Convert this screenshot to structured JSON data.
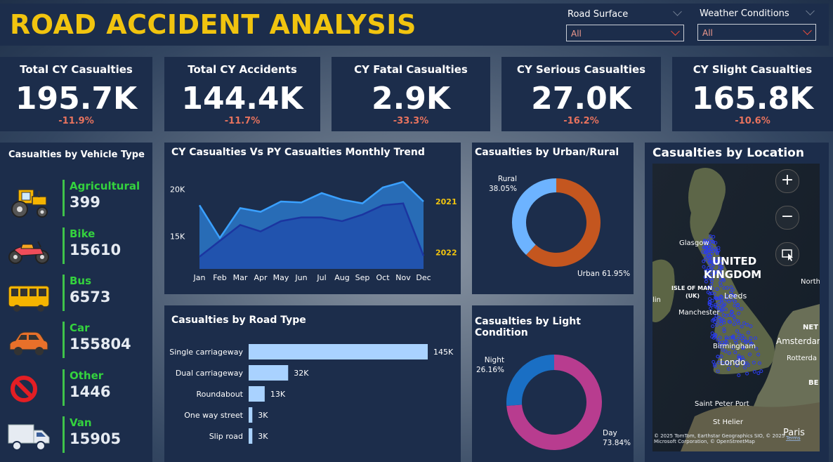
{
  "header": {
    "title": "ROAD ACCIDENT ANALYSIS"
  },
  "filters": [
    {
      "label": "Road Surface",
      "value": "All"
    },
    {
      "label": "Weather Conditions",
      "value": "All"
    }
  ],
  "kpis": [
    {
      "title": "Total CY Casualties",
      "value": "195.7K",
      "change": "-11.9%"
    },
    {
      "title": "Total CY Accidents",
      "value": "144.4K",
      "change": "-11.7%"
    },
    {
      "title": "CY Fatal Casualties",
      "value": "2.9K",
      "change": "-33.3%"
    },
    {
      "title": "CY Serious Casualties",
      "value": "27.0K",
      "change": "-16.2%"
    },
    {
      "title": "CY Slight Casualties",
      "value": "165.8K",
      "change": "-10.6%"
    }
  ],
  "vehicle_panel": {
    "title": "Casualties by Vehicle Type",
    "items": [
      {
        "label": "Agricultural",
        "value": "399",
        "icon": "tractor-icon"
      },
      {
        "label": "Bike",
        "value": "15610",
        "icon": "motorbike-icon"
      },
      {
        "label": "Bus",
        "value": "6573",
        "icon": "bus-icon"
      },
      {
        "label": "Car",
        "value": "155804",
        "icon": "car-icon"
      },
      {
        "label": "Other",
        "value": "1446",
        "icon": "prohibited-icon"
      },
      {
        "label": "Van",
        "value": "15905",
        "icon": "van-icon"
      }
    ]
  },
  "map": {
    "title": "Casualties by Location",
    "labels": [
      "Glasgow",
      "UNITED",
      "KINGDOM",
      "ISLE OF MAN",
      "(UK)",
      "Leeds",
      "Manchester",
      "Birmingham",
      "Londo",
      "NET",
      "Amsterdam",
      "Rotterda",
      "BE",
      "North",
      "lin",
      "Saint Peter Port",
      "St Helier",
      "Paris",
      "© 2025 TomTom, Earthstar Geographics SIO, © 2025 Microsoft Corporation, © OpenStreetMap",
      "Terms"
    ],
    "controls": {
      "zoom_in": "+",
      "zoom_out": "−"
    }
  },
  "chart_data": [
    {
      "type": "area",
      "title": "CY Casualties Vs PY Casualties Monthly Trend",
      "categories": [
        "Jan",
        "Feb",
        "Mar",
        "Apr",
        "May",
        "Jun",
        "Jul",
        "Aug",
        "Sep",
        "Oct",
        "Nov",
        "Dec"
      ],
      "series": [
        {
          "name": "2021",
          "values": [
            18300,
            14800,
            18000,
            17600,
            18700,
            18600,
            19600,
            18900,
            18500,
            20200,
            20800,
            18700
          ],
          "color": "#2f8ff0"
        },
        {
          "name": "2022",
          "values": [
            12800,
            14500,
            16200,
            15500,
            16600,
            17000,
            17000,
            16600,
            17300,
            18300,
            18500,
            12900
          ],
          "color": "#1c3fa8"
        }
      ],
      "y_ticks": [
        "15K",
        "20K"
      ],
      "ylim": [
        11500,
        22000
      ]
    },
    {
      "type": "pie",
      "title": "Casualties by Urban/Rural",
      "slices": [
        {
          "label": "Urban",
          "value": 61.95,
          "display": "61.95%",
          "color": "#c4561f"
        },
        {
          "label": "Rural",
          "value": 38.05,
          "display": "38.05%",
          "color": "#6db3ff"
        }
      ]
    },
    {
      "type": "bar",
      "title": "Casualties by Road Type",
      "categories": [
        "Single carriageway",
        "Dual carriageway",
        "Roundabout",
        "One way street",
        "Slip road"
      ],
      "values": [
        145000,
        32000,
        13000,
        3000,
        3000
      ],
      "labels": [
        "145K",
        "32K",
        "13K",
        "3K",
        "3K"
      ],
      "color": "#a9d2ff"
    },
    {
      "type": "pie",
      "title": "Casualties by Light Condition",
      "slices": [
        {
          "label": "Day",
          "value": 73.84,
          "display": "73.84%",
          "color": "#b83c8f"
        },
        {
          "label": "Night",
          "value": 26.16,
          "display": "26.16%",
          "color": "#1a6fc4"
        }
      ]
    }
  ]
}
